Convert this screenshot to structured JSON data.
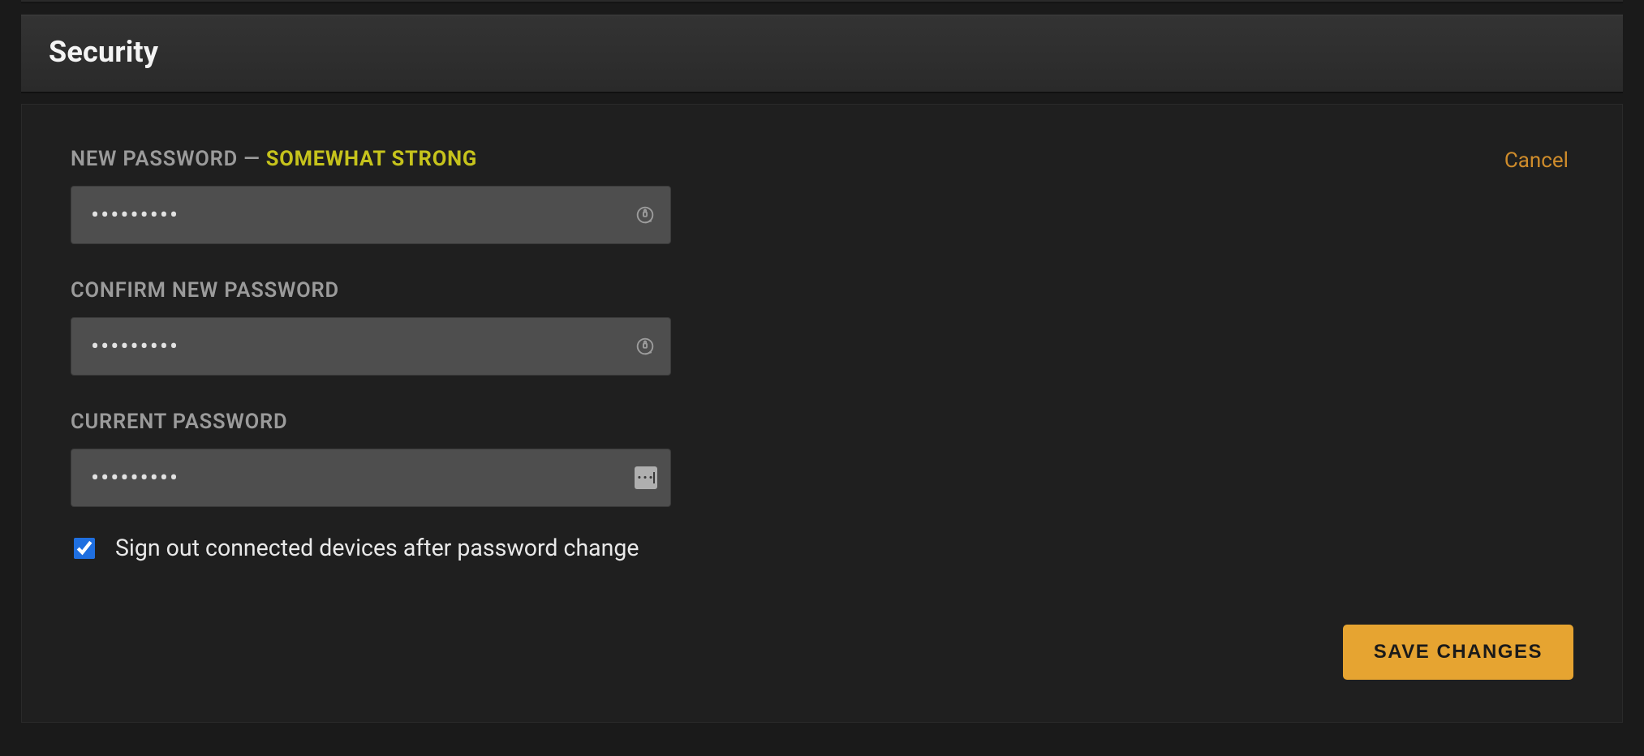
{
  "section": {
    "title": "Security"
  },
  "form": {
    "new_password": {
      "label": "NEW PASSWORD",
      "separator": " — ",
      "strength": "SOMEWHAT STRONG",
      "value": "•••••••••"
    },
    "confirm_password": {
      "label": "CONFIRM NEW PASSWORD",
      "value": "•••••••••"
    },
    "current_password": {
      "label": "CURRENT PASSWORD",
      "value": "•••••••••"
    },
    "signout_checkbox": {
      "label": "Sign out connected devices after password change",
      "checked": true
    },
    "cancel_label": "Cancel",
    "save_label": "SAVE CHANGES"
  },
  "colors": {
    "accent": "#e6a431",
    "link": "#cf8c2b",
    "strength": "#c6c31c"
  }
}
